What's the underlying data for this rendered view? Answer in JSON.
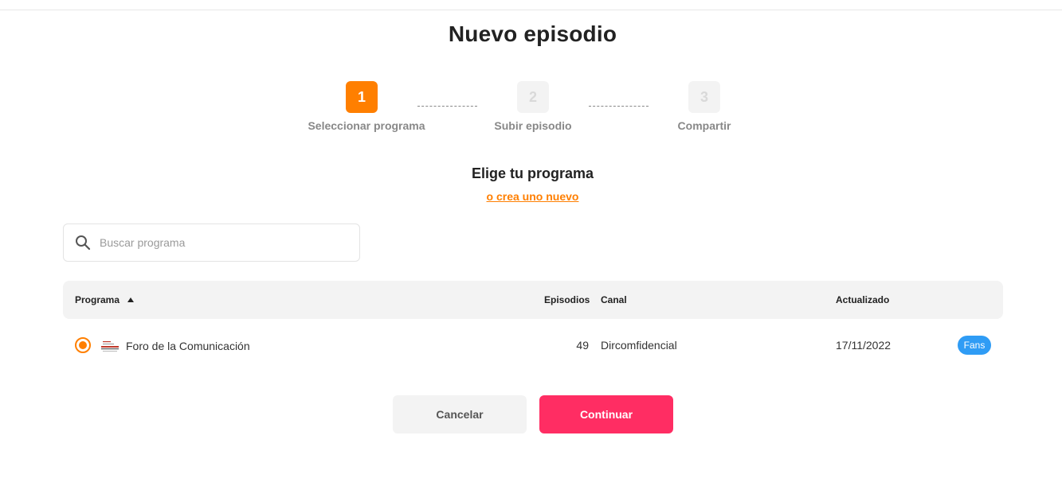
{
  "page": {
    "title": "Nuevo episodio"
  },
  "steps": [
    {
      "number": "1",
      "label": "Seleccionar programa",
      "state": "active"
    },
    {
      "number": "2",
      "label": "Subir episodio",
      "state": "inactive"
    },
    {
      "number": "3",
      "label": "Compartir",
      "state": "inactive"
    }
  ],
  "picker": {
    "heading": "Elige tu programa",
    "create_link": "o crea uno nuevo"
  },
  "search": {
    "placeholder": "Buscar programa",
    "value": "",
    "icon": "search-icon"
  },
  "table": {
    "columns": {
      "programa": "Programa",
      "episodios": "Episodios",
      "canal": "Canal",
      "actualizado": "Actualizado"
    },
    "sort": {
      "column": "Programa",
      "direction": "ascending",
      "icon": "sort-up-icon"
    },
    "rows": [
      {
        "selected": true,
        "programa": "Foro de la Comunicación",
        "episodios": "49",
        "canal": "Dircomfidencial",
        "actualizado": "17/11/2022",
        "badge": "Fans"
      }
    ]
  },
  "actions": {
    "cancel": "Cancelar",
    "continue": "Continuar"
  },
  "colors": {
    "accent": "#ff7f00",
    "continue_button": "#ff2d63",
    "badge": "#2f9cf5",
    "step_inactive": "#f3f3f3"
  }
}
